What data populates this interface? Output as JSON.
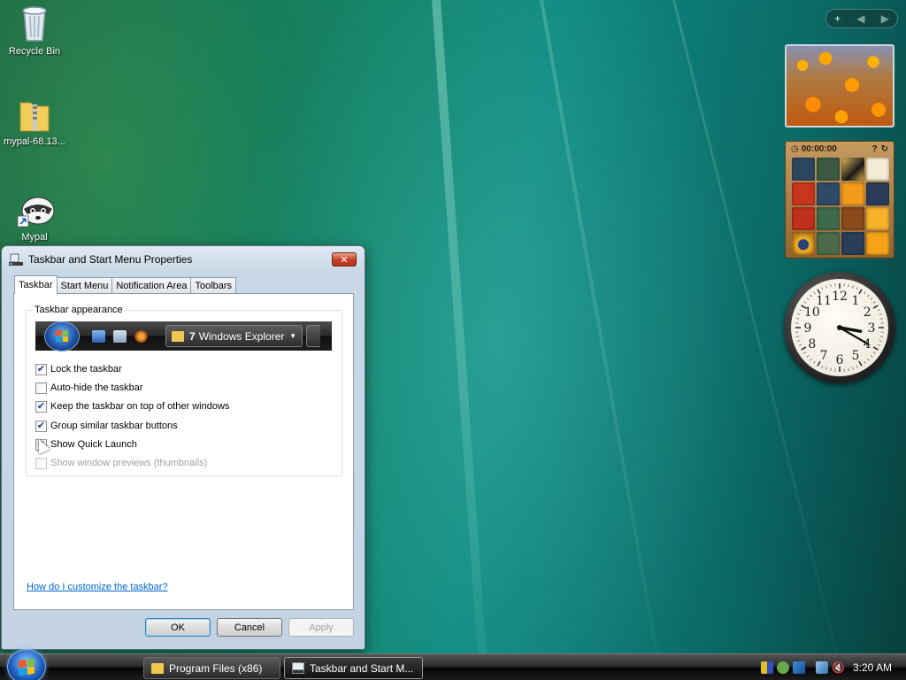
{
  "desktop": {
    "icons": [
      {
        "label": "Recycle Bin"
      },
      {
        "label": "mypal-68.13..."
      },
      {
        "label": "Mypal"
      }
    ]
  },
  "gadgets": {
    "puzzle_timer": "00:00:00",
    "clock_numbers": [
      "12",
      "1",
      "2",
      "3",
      "4",
      "5",
      "6",
      "7",
      "8",
      "9",
      "10",
      "11"
    ],
    "clock_time": {
      "hour": 3,
      "minute": 20
    }
  },
  "dialog": {
    "title": "Taskbar and Start Menu Properties",
    "close_glyph": "✕",
    "tabs": [
      {
        "label": "Taskbar",
        "active": true
      },
      {
        "label": "Start Menu",
        "active": false
      },
      {
        "label": "Notification Area",
        "active": false
      },
      {
        "label": "Toolbars",
        "active": false
      }
    ],
    "group_label": "Taskbar appearance",
    "preview": {
      "button_count": "7",
      "button_label": "Windows Explorer"
    },
    "options": [
      {
        "label": "Lock the taskbar",
        "checked": true,
        "enabled": true
      },
      {
        "label": "Auto-hide the taskbar",
        "checked": false,
        "enabled": true
      },
      {
        "label": "Keep the taskbar on top of other windows",
        "checked": true,
        "enabled": true
      },
      {
        "label": "Group similar taskbar buttons",
        "checked": true,
        "enabled": true
      },
      {
        "label": "Show Quick Launch",
        "checked": true,
        "enabled": true
      },
      {
        "label": "Show window previews (thumbnails)",
        "checked": false,
        "enabled": false
      }
    ],
    "help_link": "How do I customize the taskbar?",
    "buttons": {
      "ok": "OK",
      "cancel": "Cancel",
      "apply": "Apply"
    }
  },
  "taskbar": {
    "items": [
      {
        "label": "Program Files (x86)"
      },
      {
        "label": "Taskbar and Start M..."
      }
    ],
    "time": "3:20 AM"
  },
  "colors": {
    "accent": "#1c3f94",
    "link": "#0066cc",
    "close_button": "#c7442a"
  }
}
